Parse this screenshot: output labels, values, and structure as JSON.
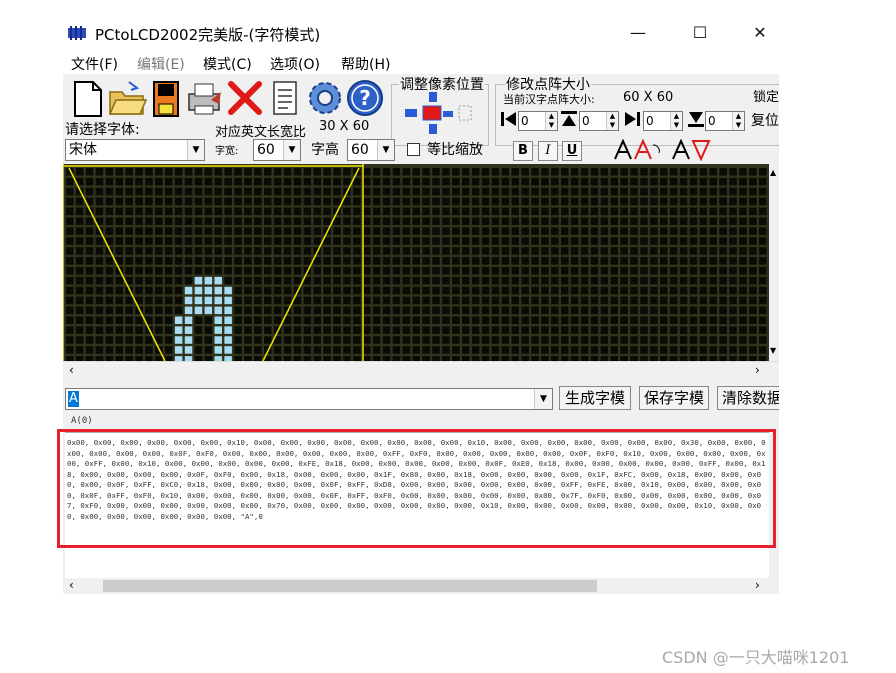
{
  "window": {
    "title": "PCtoLCD2002完美版-(字符模式)",
    "controls": {
      "minimize": "—",
      "maximize": "☐",
      "close": "✕"
    }
  },
  "menu": [
    "文件(F)",
    "编辑(E)",
    "模式(C)",
    "选项(O)",
    "帮助(H)"
  ],
  "toolbar": {
    "icons": [
      "new-file-icon",
      "open-folder-icon",
      "save-icon",
      "print-icon",
      "delete-x-icon",
      "notepad-icon",
      "settings-gear-icon",
      "help-icon"
    ],
    "adjust_pixel_label": "调整像素位置",
    "resize_matrix_label": "修改点阵大小",
    "current_matrix_label": "当前汉字点阵大小:",
    "current_matrix_value": "60 X 60",
    "lock_label": "锁定",
    "reset_label": "复位",
    "spin_values": [
      "0",
      "0",
      "0",
      "0"
    ],
    "font_prompt": "请选择字体:",
    "font_value": "宋体",
    "english_width_label": "对应英文长宽比",
    "english_width_value": "30 X 60",
    "char_width_label": "字宽:",
    "char_width_value": "60",
    "char_height_label": "字高",
    "char_height_value": "60",
    "proportional_label": "等比缩放",
    "bold": "B",
    "italic": "I",
    "underline": "U"
  },
  "input": {
    "value": "A",
    "generate_button": "生成字模",
    "save_button": "保存字模",
    "clear_button": "清除数据"
  },
  "preview_tag": "A(0)",
  "output_text": "0x00, 0x00, 0x00, 0x00, 0x00, 0x00, 0x10, 0x00, 0x00, 0x00, 0x00, 0x00, 0x00, 0x00, 0x00, 0x10, 0x00, 0x00, 0x00, 0x00, 0x00, 0x00, 0x00, 0x30, 0x00, 0x00, 0x00, 0x00, 0x00, 0x00, 0x0F, 0xF0, 0x00, 0x00, 0x00, 0x00, 0x00, 0x00, 0xFF, 0xF0, 0x00, 0x00, 0x00, 0x00, 0x00, 0x0F, 0xF0, 0x10, 0x00, 0x00, 0x00, 0x00, 0x00, 0xFF, 0x00, 0x10, 0x00, 0x00, 0x00, 0x00, 0x00, 0xFE, 0x18, 0x00, 0x00, 0x00, 0x00, 0x00, 0x0F, 0xE0, 0x18, 0x00, 0x00, 0x00, 0x00, 0x00, 0xFF, 0x00, 0x18, 0x00, 0x00, 0x00, 0x00, 0x0F, 0xF0, 0x00, 0x18, 0x00, 0x00, 0x00, 0x1F, 0x80, 0x00, 0x18, 0x00, 0x00, 0x00, 0x00, 0x1F, 0xFC, 0x00, 0x18, 0x00, 0x00, 0x00, 0x00, 0x0F, 0xFF, 0xC0, 0x18, 0x00, 0x00, 0x00, 0x00, 0x0F, 0xFF, 0xD8, 0x00, 0x00, 0x00, 0x00, 0x00, 0x00, 0xFF, 0xFE, 0x00, 0x10, 0x00, 0x00, 0x00, 0x00, 0x0F, 0xFF, 0xF0, 0x10, 0x00, 0x00, 0x00, 0x00, 0x00, 0x0F, 0xFF, 0xF0, 0x00, 0x00, 0x00, 0x00, 0x00, 0x00, 0x7F, 0xF0, 0x00, 0x00, 0x00, 0x00, 0x00, 0x07, 0xF0, 0x00, 0x00, 0x00, 0x00, 0x00, 0x00, 0x70, 0x00, 0x00, 0x00, 0x00, 0x00, 0x00, 0x00, 0x10, 0x00, 0x00, 0x00, 0x00, 0x00, 0x00, 0x00, 0x10, 0x00, 0x00, 0x00, 0x00, 0x00, 0x00, 0x00, 0x00, \"A\",0",
  "watermark": "CSDN @一只大喵咪1201",
  "colors": {
    "matrix_bg": "#2f331c",
    "grid_cell": "#0b0b05",
    "pixel_on": "#a9dcf2",
    "guide_line": "#f1e600",
    "highlight": "#e8202a"
  }
}
